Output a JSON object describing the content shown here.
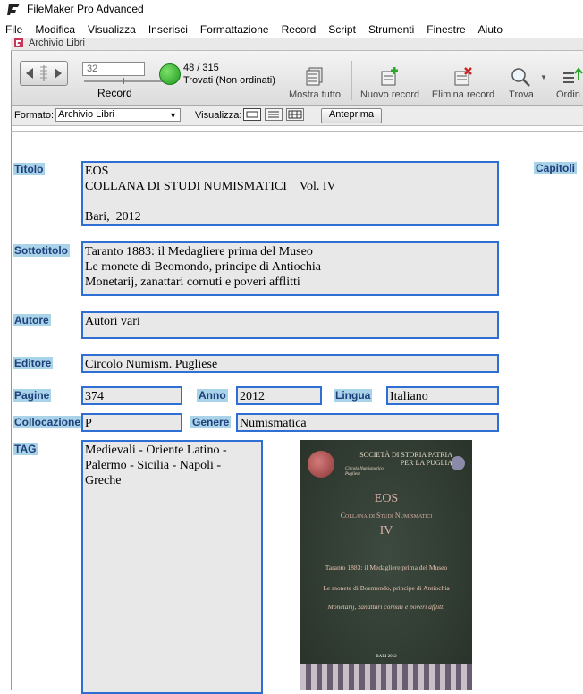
{
  "app": {
    "title": "FileMaker Pro Advanced"
  },
  "menu": [
    "File",
    "Modifica",
    "Visualizza",
    "Inserisci",
    "Formattazione",
    "Record",
    "Script",
    "Strumenti",
    "Finestre",
    "Aiuto"
  ],
  "window": {
    "title": "Archivio Libri"
  },
  "toolbar": {
    "record_number": "32",
    "record_label": "Record",
    "count": "48 / 315",
    "found": "Trovati (Non ordinati)",
    "show_all": "Mostra tutto",
    "new_record": "Nuovo record",
    "delete_record": "Elimina record",
    "find": "Trova",
    "sort": "Ordin"
  },
  "layoutbar": {
    "format_label": "Formato:",
    "format_value": "Archivio Libri",
    "view_label": "Visualizza:",
    "preview": "Anteprima"
  },
  "form": {
    "labels": {
      "titolo": "Titolo",
      "capitoli": "Capitoli",
      "sottotitolo": "Sottotitolo",
      "autore": "Autore",
      "editore": "Editore",
      "pagine": "Pagine",
      "anno": "Anno",
      "lingua": "Lingua",
      "collocazione": "Collocazione",
      "genere": "Genere",
      "tag": "TAG"
    },
    "values": {
      "titolo": "EOS\nCOLLANA DI STUDI NUMISMATICI    Vol. IV\n\nBari,  2012",
      "sottotitolo": "Taranto 1883: il Medagliere prima del Museo\nLe monete di Beomondo, principe di Antiochia\nMonetarij, zanattari cornuti e poveri afflitti",
      "autore": "Autori vari",
      "editore": "Circolo Numism. Pugliese",
      "pagine": "374",
      "anno": "2012",
      "lingua": "Italiano",
      "collocazione": "P",
      "genere": "Numismatica",
      "tag": "Medievali - Oriente Latino - Palermo - Sicilia - Napoli - Greche"
    }
  },
  "cover": {
    "society": "Società di Storia Patria per la Puglia",
    "circolo": "Circolo Numismatico Pugliese",
    "title": "EOS",
    "series": "Collana di Studi Numismatici",
    "volume": "IV",
    "line1": "Taranto 1883: il Medagliere prima del Museo",
    "line2": "Le monete di Boemondo, principe di Antiochia",
    "line3": "Monetarij, zanattari cornuti e poveri afflitti",
    "place": "BARI 2012"
  }
}
